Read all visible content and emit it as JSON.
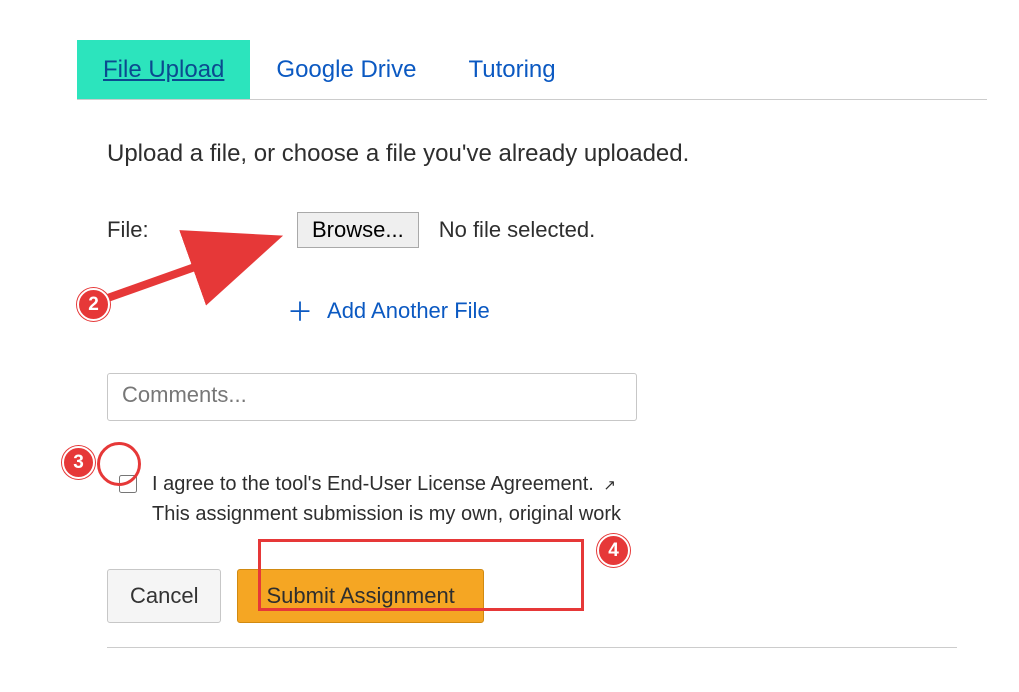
{
  "tabs": {
    "file_upload": "File Upload",
    "google_drive": "Google Drive",
    "tutoring": "Tutoring"
  },
  "instruction": "Upload a file, or choose a file you've already uploaded.",
  "file": {
    "label": "File:",
    "browse": "Browse...",
    "no_file": "No file selected."
  },
  "add_another": "Add Another File",
  "comments_placeholder": "Comments...",
  "agreement": {
    "line1": "I agree to the tool's End-User License Agreement.",
    "line2": "This assignment submission is my own, original work"
  },
  "buttons": {
    "cancel": "Cancel",
    "submit": "Submit Assignment"
  },
  "annotations": {
    "n2": "2",
    "n3": "3",
    "n4": "4"
  }
}
